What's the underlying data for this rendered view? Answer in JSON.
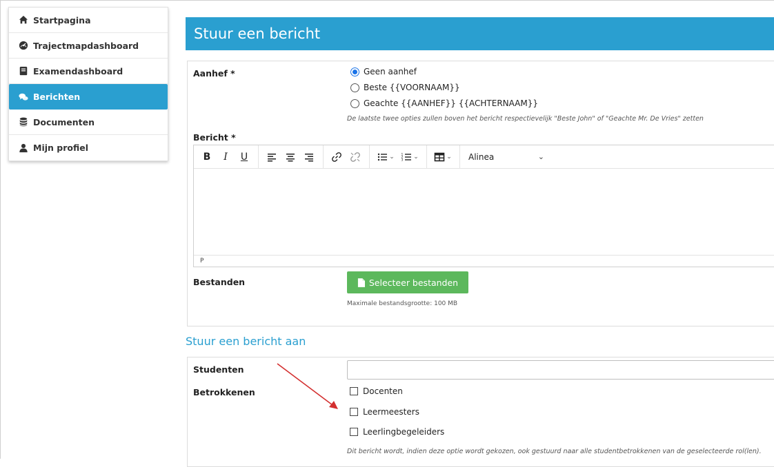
{
  "sidebar": {
    "items": [
      {
        "label": "Startpagina",
        "icon": "home-icon",
        "active": false
      },
      {
        "label": "Trajectmapdashboard",
        "icon": "dashboard-gauge-icon",
        "active": false
      },
      {
        "label": "Examendashboard",
        "icon": "book-icon",
        "active": false
      },
      {
        "label": "Berichten",
        "icon": "chat-bubbles-icon",
        "active": true
      },
      {
        "label": "Documenten",
        "icon": "database-icon",
        "active": false
      },
      {
        "label": "Mijn profiel",
        "icon": "user-icon",
        "active": false
      }
    ]
  },
  "header": {
    "title": "Stuur een bericht"
  },
  "form": {
    "aanhef_label": "Aanhef *",
    "aanhef_options": [
      "Geen aanhef",
      "Beste {{VOORNAAM}}",
      "Geachte {{AANHEF}} {{ACHTERNAAM}}"
    ],
    "aanhef_selected": 0,
    "aanhef_hint": "De laatste twee opties zullen boven het bericht respectievelijk \"Beste John\" of \"Geachte Mr. De Vries\" zetten",
    "bericht_label": "Bericht *",
    "editor": {
      "format_value": "Alinea",
      "status_path": "P"
    },
    "bestanden_label": "Bestanden",
    "select_files_button": "Selecteer bestanden",
    "max_size_hint": "Maximale bestandsgrootte: 100 MB"
  },
  "recipients": {
    "title": "Stuur een bericht aan",
    "studenten_label": "Studenten",
    "studenten_value": "",
    "betrokkenen_label": "Betrokkenen",
    "options": [
      "Docenten",
      "Leermeesters",
      "Leerlingbegeleiders"
    ],
    "hint": "Dit bericht wordt, indien deze optie wordt gekozen, ook gestuurd naar alle studentbetrokkenen van de geselecteerde rol(len)."
  },
  "colors": {
    "accent": "#2a9fd0",
    "button_green": "#5cb85c",
    "annotation_arrow": "#d32f2f",
    "radio_checked": "#1a73e8"
  }
}
